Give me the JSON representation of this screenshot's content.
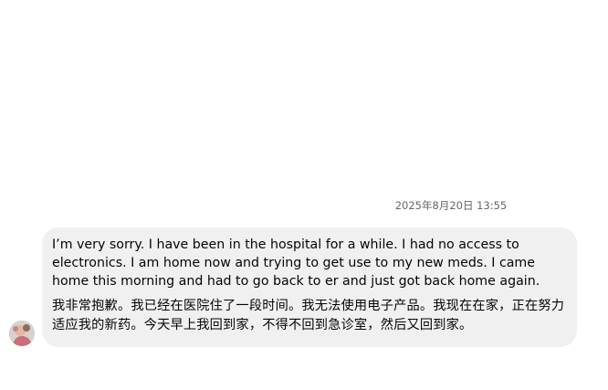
{
  "conversation": {
    "timestamp": "2025年8月20日 13:55",
    "message": {
      "text_en": "I’m very sorry. I have been in the hospital for a while. I had no access to electronics. I am home now and trying to get use to my new meds. I came home this morning and had to go back to er and just got back home again.",
      "text_zh": "我非常抱歉。我已经在医院住了一段时间。我无法使用电子产品。我现在在家，正在努力适应我的新药。今天早上我回到家，不得不回到急诊室，然后又回到家。"
    },
    "avatar_icon": "contact-avatar-photo"
  },
  "colors": {
    "bubble_bg": "#f0f0f0",
    "timestamp": "#65676b",
    "text": "#050505"
  }
}
